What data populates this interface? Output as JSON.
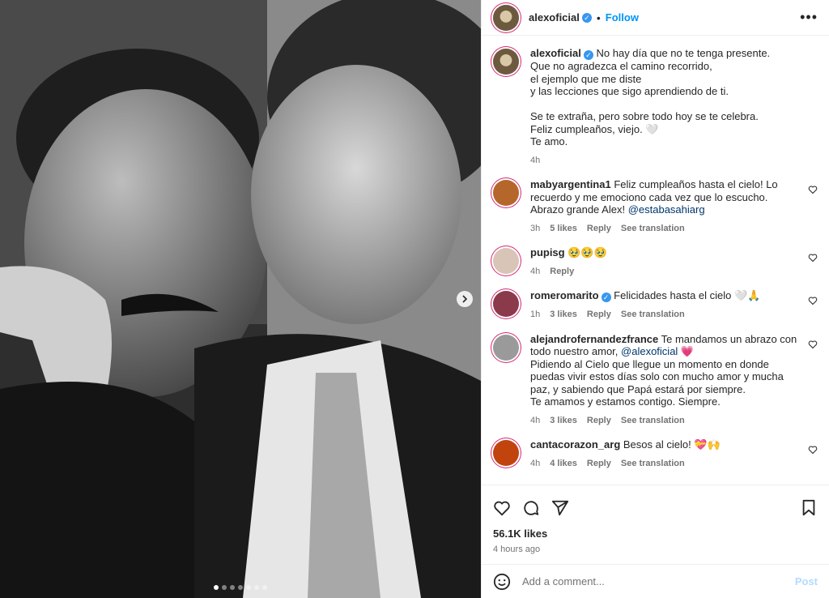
{
  "header": {
    "username": "alexoficial",
    "separator": "•",
    "follow_label": "Follow",
    "more_icon": "more-options-icon",
    "more_label": "•••"
  },
  "caption": {
    "username": "alexoficial",
    "text": "No hay día que no te tenga presente.\nQue no agradezca el camino recorrido,\nel ejemplo que me diste\ny las lecciones que sigo aprendiendo de ti.\n\nSe te extraña, pero sobre todo hoy se te celebra.\nFeliz cumpleaños, viejo. 🤍\nTe amo.",
    "time": "4h"
  },
  "comments": [
    {
      "username": "mabyargentina1",
      "verified": false,
      "text": "Feliz cumpleaños hasta el cielo! Lo recuerdo y me emociono cada vez que lo escucho. Abrazo grande Alex!",
      "mention": "@estabasahiarg",
      "time": "3h",
      "likes": "5 likes",
      "reply": "Reply",
      "translation": "See translation",
      "avatar_color": "#b5672b"
    },
    {
      "username": "pupisg",
      "verified": false,
      "text": "🥹🥹🥹",
      "mention": "",
      "time": "4h",
      "likes": "",
      "reply": "Reply",
      "translation": "",
      "avatar_color": "#d8c5b8"
    },
    {
      "username": "romeromarito",
      "verified": true,
      "text": "Felicidades hasta el cielo 🤍🙏",
      "mention": "",
      "time": "1h",
      "likes": "3 likes",
      "reply": "Reply",
      "translation": "See translation",
      "avatar_color": "#8a3a4a"
    },
    {
      "username": "alejandrofernandezfrance",
      "verified": false,
      "text": "Te mandamos un abrazo con todo nuestro amor,",
      "mention": "@alexoficial 💗",
      "extra": "Pidiendo al Cielo que llegue un momento en donde puedas vivir estos días solo con mucho amor y mucha paz, y sabiendo que Papá estará por siempre.\nTe amamos y estamos contigo. Siempre.",
      "time": "4h",
      "likes": "3 likes",
      "reply": "Reply",
      "translation": "See translation",
      "avatar_color": "#9a9a9a"
    },
    {
      "username": "cantacorazon_arg",
      "verified": false,
      "text": "Besos al cielo! 💝🙌",
      "mention": "",
      "time": "4h",
      "likes": "4 likes",
      "reply": "Reply",
      "translation": "See translation",
      "avatar_color": "#c1440e"
    }
  ],
  "actions": {
    "like_icon": "heart-icon",
    "comment_icon": "comment-icon",
    "share_icon": "share-icon",
    "save_icon": "bookmark-icon",
    "likes": "56.1K likes",
    "posted": "4 hours ago"
  },
  "add_comment": {
    "emoji_icon": "emoji-icon",
    "placeholder": "Add a comment...",
    "post_label": "Post"
  },
  "carousel": {
    "active_index": 0,
    "count": 7,
    "next_icon": "chevron-right-icon"
  },
  "colors": {
    "accent": "#0095f6",
    "verified": "#3797f0",
    "muted": "#737373",
    "mention": "#00376b"
  }
}
